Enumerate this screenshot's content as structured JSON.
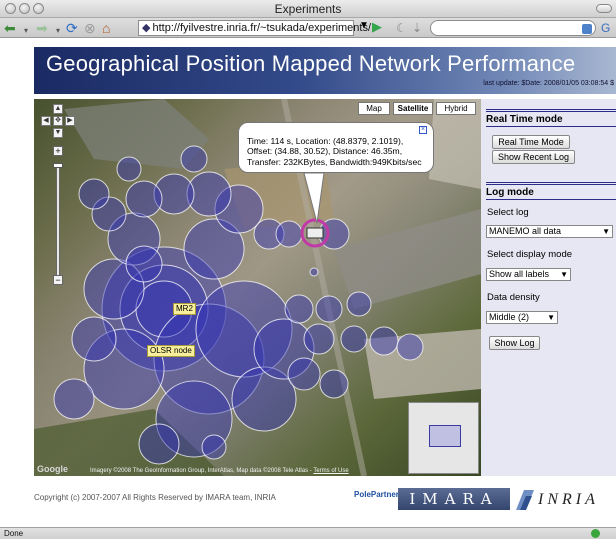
{
  "window": {
    "title": "Experiments"
  },
  "toolbar": {
    "url": "http://fyilvestre.inria.fr/~tsukada/experiments/",
    "search_value": ""
  },
  "banner": {
    "title": "Geographical Position Mapped Network Performance",
    "last_update": "last update: $Date: 2008/01/05 03:08:54 $"
  },
  "map": {
    "type_buttons": [
      "Map",
      "Satellite",
      "Hybrid"
    ],
    "selected_type": "Satellite",
    "info": {
      "lines": [
        "Time: 114 s, Location: (48.8379, 2.1019),",
        "Offset: (34.88, 30.52), Distance: 46.35m,",
        "Transfer: 232KBytes, Bandwidth:949Kbits/sec"
      ]
    },
    "labels": {
      "mr2": "MR2",
      "olsr": "OLSR node"
    },
    "attribution": "Imagery ©2008 The GeoInformation Group, InterAtlas, Map data ©2008 Tele Atlas - ",
    "terms_link": "Terms of Use",
    "google_logo": "Google"
  },
  "side": {
    "realtime_heading": "Real Time mode",
    "realtime_button": "Real Time Mode",
    "recent_log_button": "Show Recent Log",
    "log_heading": "Log mode",
    "select_log_label": "Select log",
    "select_log_value": "MANEMO all data",
    "display_mode_label": "Select display mode",
    "display_mode_value": "Show all labels",
    "density_label": "Data density",
    "density_value": "Middle (2)",
    "show_log_button": "Show Log"
  },
  "footer": {
    "copyright": "Copyright (c) 2007-2007 All Rights Reserved by IMARA team, INRIA",
    "imara_logo": "IMARA",
    "inria_logo": "INRIA",
    "partner_logo": "PolePartner"
  },
  "status": {
    "text": "Done"
  },
  "colors": {
    "accent": "#2c2c8c",
    "circle_fill": "#3a3ab0",
    "banner": "#1a2a63"
  }
}
